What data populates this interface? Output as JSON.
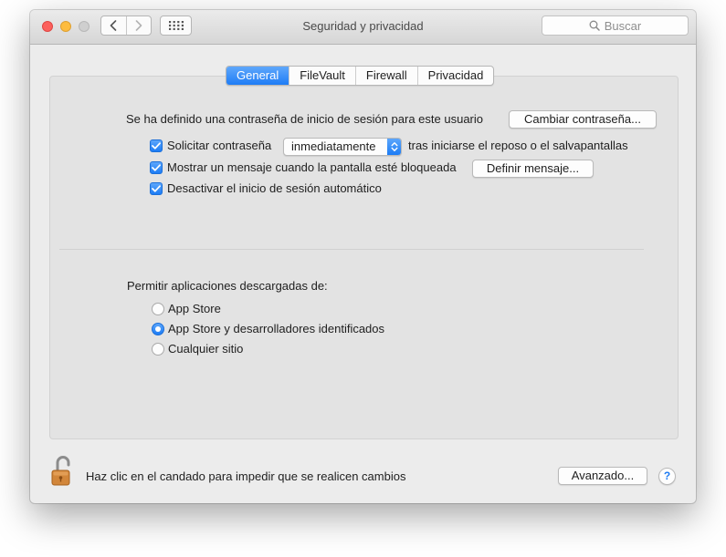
{
  "window": {
    "title": "Seguridad y privacidad"
  },
  "search": {
    "placeholder": "Buscar"
  },
  "tabs": [
    {
      "label": "General",
      "selected": true
    },
    {
      "label": "FileVault",
      "selected": false
    },
    {
      "label": "Firewall",
      "selected": false
    },
    {
      "label": "Privacidad",
      "selected": false
    }
  ],
  "general": {
    "password_note": "Se ha definido una contraseña de inicio de sesión para este usuario",
    "change_password_button": "Cambiar contraseña...",
    "require_password": {
      "label": "Solicitar contraseña",
      "checked": true,
      "select_value": "inmediatamente",
      "suffix": "tras iniciarse el reposo o el salvapantallas"
    },
    "show_message": {
      "label": "Mostrar un mensaje cuando la pantalla esté bloqueada",
      "checked": true,
      "button": "Definir mensaje..."
    },
    "disable_auto_login": {
      "label": "Desactivar el inicio de sesión automático",
      "checked": true
    }
  },
  "downloads": {
    "heading": "Permitir aplicaciones descargadas de:",
    "options": [
      {
        "label": "App Store",
        "selected": false
      },
      {
        "label": "App Store y desarrolladores identificados",
        "selected": true
      },
      {
        "label": "Cualquier sitio",
        "selected": false
      }
    ]
  },
  "footer": {
    "lock_text": "Haz clic en el candado para impedir que se realicen cambios",
    "advanced_button": "Avanzado...",
    "help_label": "?"
  },
  "icons": {
    "back": "chevron-left-icon",
    "forward": "chevron-right-icon",
    "show_all": "grid-icon",
    "search": "search-icon",
    "lock": "lock-open-icon"
  },
  "colors": {
    "accent": "#1e7df6",
    "close": "#fc605c",
    "minimize": "#fdbc40",
    "lock_body": "#d2863a"
  }
}
